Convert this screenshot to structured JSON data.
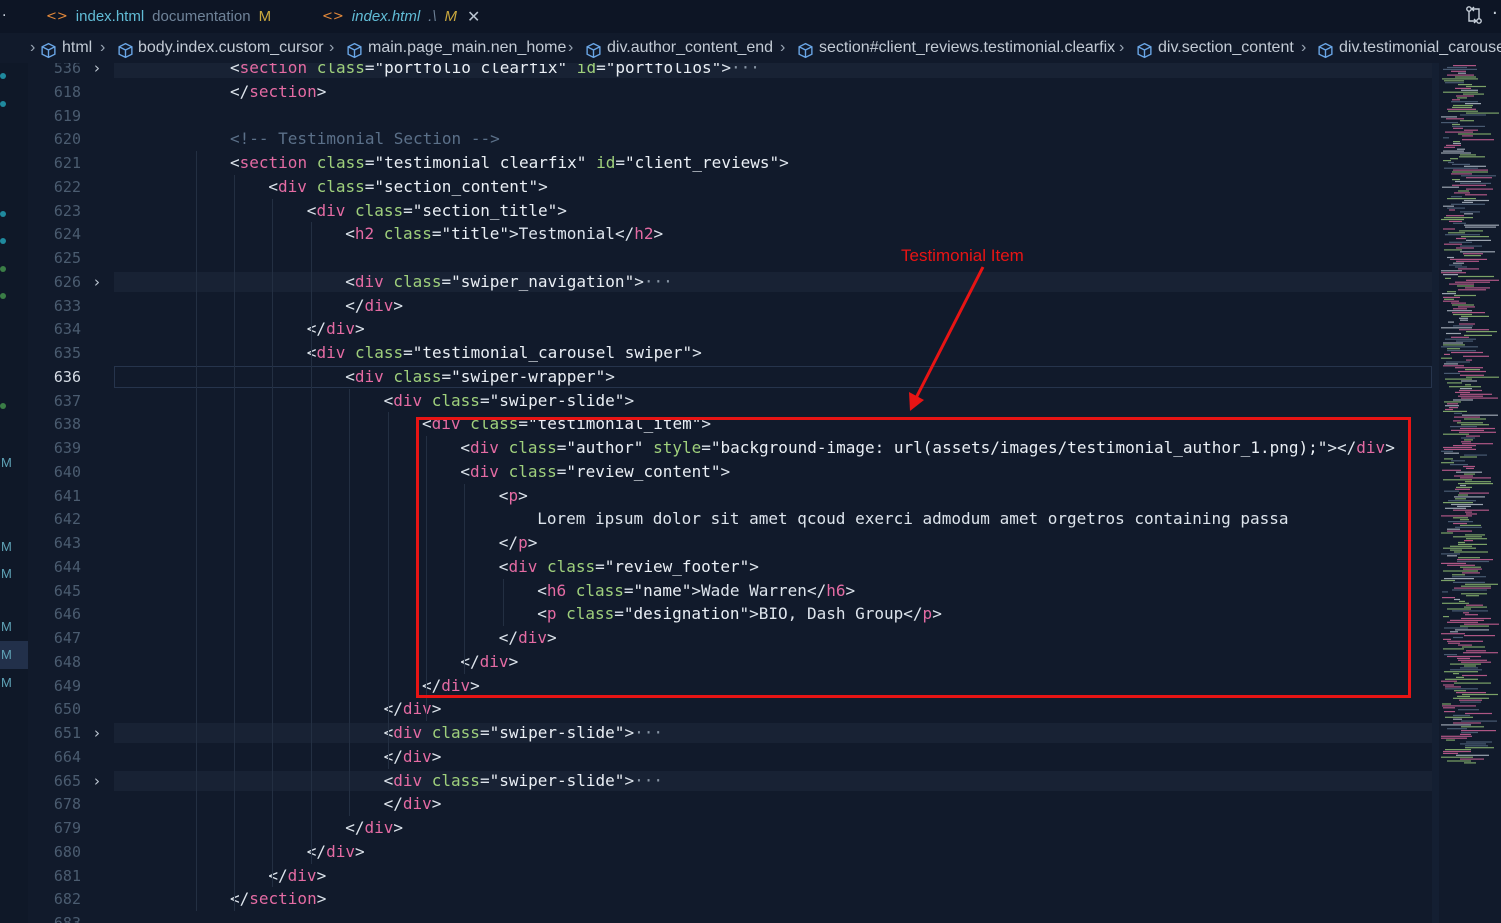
{
  "tabs": [
    {
      "name": "index.html",
      "dir": "documentation",
      "modified": "M",
      "icon": "html-file-icon"
    },
    {
      "name": "index.html",
      "dir": ".\\",
      "modified": "M",
      "icon": "html-file-icon",
      "active": true
    }
  ],
  "breadcrumb": [
    "html",
    "body.index.custom_cursor",
    "main.page_main.nen_home",
    "div.author_content_end",
    "section#client_reviews.testimonial.clearfix",
    "div.section_content",
    "div.testimonial_carousel.swiper"
  ],
  "annotation": {
    "label": "Testimonial Item",
    "color": "#e81414"
  },
  "colors": {
    "tag": "#e46ba3",
    "attr": "#9fd07c",
    "string": "#eaeff5",
    "comment": "#5b7089",
    "background": "#111a2b"
  },
  "lines": [
    {
      "num": "536",
      "fold": true,
      "indent": 4,
      "parts": [
        [
          "<",
          "pun"
        ],
        [
          "section",
          "tag"
        ],
        [
          " class",
          "attr"
        ],
        [
          "=",
          "pun"
        ],
        [
          "\"portfolio clearfix\"",
          "str"
        ],
        [
          " id",
          "attr"
        ],
        [
          "=",
          "pun"
        ],
        [
          "\"portfolios\"",
          "str"
        ],
        [
          ">",
          "pun"
        ],
        [
          "···",
          "ell"
        ]
      ]
    },
    {
      "num": "618",
      "indent": 4,
      "parts": [
        [
          "</",
          "pun"
        ],
        [
          "section",
          "tag"
        ],
        [
          ">",
          "pun"
        ]
      ]
    },
    {
      "num": "619",
      "indent": 0,
      "parts": []
    },
    {
      "num": "620",
      "indent": 4,
      "parts": [
        [
          "<!-- Testimonial Section -->",
          "cmt"
        ]
      ]
    },
    {
      "num": "621",
      "indent": 4,
      "parts": [
        [
          "<",
          "pun"
        ],
        [
          "section",
          "tag"
        ],
        [
          " class",
          "attr"
        ],
        [
          "=",
          "pun"
        ],
        [
          "\"testimonial clearfix\"",
          "str"
        ],
        [
          " id",
          "attr"
        ],
        [
          "=",
          "pun"
        ],
        [
          "\"client_reviews\"",
          "str"
        ],
        [
          ">",
          "pun"
        ]
      ]
    },
    {
      "num": "622",
      "indent": 5,
      "parts": [
        [
          "<",
          "pun"
        ],
        [
          "div",
          "tag"
        ],
        [
          " class",
          "attr"
        ],
        [
          "=",
          "pun"
        ],
        [
          "\"section_content\"",
          "str"
        ],
        [
          ">",
          "pun"
        ]
      ]
    },
    {
      "num": "623",
      "indent": 6,
      "parts": [
        [
          "<",
          "pun"
        ],
        [
          "div",
          "tag"
        ],
        [
          " class",
          "attr"
        ],
        [
          "=",
          "pun"
        ],
        [
          "\"section_title\"",
          "str"
        ],
        [
          ">",
          "pun"
        ]
      ]
    },
    {
      "num": "624",
      "indent": 7,
      "parts": [
        [
          "<",
          "pun"
        ],
        [
          "h2",
          "tag"
        ],
        [
          " class",
          "attr"
        ],
        [
          "=",
          "pun"
        ],
        [
          "\"title\"",
          "str"
        ],
        [
          ">",
          "pun"
        ],
        [
          "Testmonial",
          "txt"
        ],
        [
          "</",
          "pun"
        ],
        [
          "h2",
          "tag"
        ],
        [
          ">",
          "pun"
        ]
      ]
    },
    {
      "num": "625",
      "indent": 0,
      "parts": []
    },
    {
      "num": "626",
      "fold": true,
      "indent": 7,
      "parts": [
        [
          "<",
          "pun"
        ],
        [
          "div",
          "tag"
        ],
        [
          " class",
          "attr"
        ],
        [
          "=",
          "pun"
        ],
        [
          "\"swiper_navigation\"",
          "str"
        ],
        [
          ">",
          "pun"
        ],
        [
          "···",
          "ell"
        ]
      ]
    },
    {
      "num": "633",
      "indent": 7,
      "parts": [
        [
          "</",
          "pun"
        ],
        [
          "div",
          "tag"
        ],
        [
          ">",
          "pun"
        ]
      ]
    },
    {
      "num": "634",
      "indent": 6,
      "parts": [
        [
          "</",
          "pun"
        ],
        [
          "div",
          "tag"
        ],
        [
          ">",
          "pun"
        ]
      ]
    },
    {
      "num": "635",
      "indent": 6,
      "parts": [
        [
          "<",
          "pun"
        ],
        [
          "div",
          "tag"
        ],
        [
          " class",
          "attr"
        ],
        [
          "=",
          "pun"
        ],
        [
          "\"testimonial_carousel swiper\"",
          "str"
        ],
        [
          ">",
          "pun"
        ]
      ]
    },
    {
      "num": "636",
      "current": true,
      "indent": 7,
      "parts": [
        [
          "<",
          "pun"
        ],
        [
          "div",
          "tag"
        ],
        [
          " class",
          "attr"
        ],
        [
          "=",
          "pun"
        ],
        [
          "\"swiper-wrapper\"",
          "str"
        ],
        [
          ">",
          "pun"
        ]
      ]
    },
    {
      "num": "637",
      "indent": 8,
      "parts": [
        [
          "<",
          "pun"
        ],
        [
          "div",
          "tag"
        ],
        [
          " class",
          "attr"
        ],
        [
          "=",
          "pun"
        ],
        [
          "\"swiper-slide\"",
          "str"
        ],
        [
          ">",
          "pun"
        ]
      ]
    },
    {
      "num": "638",
      "indent": 9,
      "parts": [
        [
          "<",
          "pun"
        ],
        [
          "div",
          "tag"
        ],
        [
          " class",
          "attr"
        ],
        [
          "=",
          "pun"
        ],
        [
          "\"testimonial_item\"",
          "str"
        ],
        [
          ">",
          "pun"
        ]
      ]
    },
    {
      "num": "639",
      "indent": 10,
      "parts": [
        [
          "<",
          "pun"
        ],
        [
          "div",
          "tag"
        ],
        [
          " class",
          "attr"
        ],
        [
          "=",
          "pun"
        ],
        [
          "\"author\"",
          "str"
        ],
        [
          " style",
          "attr"
        ],
        [
          "=",
          "pun"
        ],
        [
          "\"background-image: url(assets/images/testimonial_author_1.png);\"",
          "str"
        ],
        [
          ">",
          "pun"
        ],
        [
          "</",
          "pun"
        ],
        [
          "div",
          "tag"
        ],
        [
          ">",
          "pun"
        ]
      ]
    },
    {
      "num": "640",
      "indent": 10,
      "parts": [
        [
          "<",
          "pun"
        ],
        [
          "div",
          "tag"
        ],
        [
          " class",
          "attr"
        ],
        [
          "=",
          "pun"
        ],
        [
          "\"review_content\"",
          "str"
        ],
        [
          ">",
          "pun"
        ]
      ]
    },
    {
      "num": "641",
      "indent": 11,
      "parts": [
        [
          "<",
          "pun"
        ],
        [
          "p",
          "tag"
        ],
        [
          ">",
          "pun"
        ]
      ]
    },
    {
      "num": "642",
      "indent": 12,
      "parts": [
        [
          "Lorem ipsum dolor sit amet qcoud exerci admodum amet orgetros containing passa",
          "txt"
        ]
      ]
    },
    {
      "num": "643",
      "indent": 11,
      "parts": [
        [
          "</",
          "pun"
        ],
        [
          "p",
          "tag"
        ],
        [
          ">",
          "pun"
        ]
      ]
    },
    {
      "num": "644",
      "indent": 11,
      "parts": [
        [
          "<",
          "pun"
        ],
        [
          "div",
          "tag"
        ],
        [
          " class",
          "attr"
        ],
        [
          "=",
          "pun"
        ],
        [
          "\"review_footer\"",
          "str"
        ],
        [
          ">",
          "pun"
        ]
      ]
    },
    {
      "num": "645",
      "indent": 12,
      "parts": [
        [
          "<",
          "pun"
        ],
        [
          "h6",
          "tag"
        ],
        [
          " class",
          "attr"
        ],
        [
          "=",
          "pun"
        ],
        [
          "\"name\"",
          "str"
        ],
        [
          ">",
          "pun"
        ],
        [
          "Wade Warren",
          "txt"
        ],
        [
          "</",
          "pun"
        ],
        [
          "h6",
          "tag"
        ],
        [
          ">",
          "pun"
        ]
      ]
    },
    {
      "num": "646",
      "indent": 12,
      "parts": [
        [
          "<",
          "pun"
        ],
        [
          "p",
          "tag"
        ],
        [
          " class",
          "attr"
        ],
        [
          "=",
          "pun"
        ],
        [
          "\"designation\"",
          "str"
        ],
        [
          ">",
          "pun"
        ],
        [
          "BIO, Dash Group",
          "txt"
        ],
        [
          "</",
          "pun"
        ],
        [
          "p",
          "tag"
        ],
        [
          ">",
          "pun"
        ]
      ]
    },
    {
      "num": "647",
      "indent": 11,
      "parts": [
        [
          "</",
          "pun"
        ],
        [
          "div",
          "tag"
        ],
        [
          ">",
          "pun"
        ]
      ]
    },
    {
      "num": "648",
      "indent": 10,
      "parts": [
        [
          "</",
          "pun"
        ],
        [
          "div",
          "tag"
        ],
        [
          ">",
          "pun"
        ]
      ]
    },
    {
      "num": "649",
      "indent": 9,
      "parts": [
        [
          "</",
          "pun"
        ],
        [
          "div",
          "tag"
        ],
        [
          ">",
          "pun"
        ]
      ]
    },
    {
      "num": "650",
      "indent": 8,
      "parts": [
        [
          "</",
          "pun"
        ],
        [
          "div",
          "tag"
        ],
        [
          ">",
          "pun"
        ]
      ]
    },
    {
      "num": "651",
      "fold": true,
      "indent": 8,
      "parts": [
        [
          "<",
          "pun"
        ],
        [
          "div",
          "tag"
        ],
        [
          " class",
          "attr"
        ],
        [
          "=",
          "pun"
        ],
        [
          "\"swiper-slide\"",
          "str"
        ],
        [
          ">",
          "pun"
        ],
        [
          "···",
          "ell"
        ]
      ]
    },
    {
      "num": "664",
      "indent": 8,
      "parts": [
        [
          "</",
          "pun"
        ],
        [
          "div",
          "tag"
        ],
        [
          ">",
          "pun"
        ]
      ]
    },
    {
      "num": "665",
      "fold": true,
      "indent": 8,
      "parts": [
        [
          "<",
          "pun"
        ],
        [
          "div",
          "tag"
        ],
        [
          " class",
          "attr"
        ],
        [
          "=",
          "pun"
        ],
        [
          "\"swiper-slide\"",
          "str"
        ],
        [
          ">",
          "pun"
        ],
        [
          "···",
          "ell"
        ]
      ]
    },
    {
      "num": "678",
      "indent": 8,
      "parts": [
        [
          "</",
          "pun"
        ],
        [
          "div",
          "tag"
        ],
        [
          ">",
          "pun"
        ]
      ]
    },
    {
      "num": "679",
      "indent": 7,
      "parts": [
        [
          "</",
          "pun"
        ],
        [
          "div",
          "tag"
        ],
        [
          ">",
          "pun"
        ]
      ]
    },
    {
      "num": "680",
      "indent": 6,
      "parts": [
        [
          "</",
          "pun"
        ],
        [
          "div",
          "tag"
        ],
        [
          ">",
          "pun"
        ]
      ]
    },
    {
      "num": "681",
      "indent": 5,
      "parts": [
        [
          "</",
          "pun"
        ],
        [
          "div",
          "tag"
        ],
        [
          ">",
          "pun"
        ]
      ]
    },
    {
      "num": "682",
      "indent": 4,
      "parts": [
        [
          "</",
          "pun"
        ],
        [
          "section",
          "tag"
        ],
        [
          ">",
          "pun"
        ]
      ]
    },
    {
      "num": "683",
      "indent": 0,
      "parts": []
    }
  ],
  "activity_markers": [
    {
      "kind": "dot",
      "color": "#1f8a9e"
    },
    {
      "kind": "dot",
      "color": "#1f8a9e"
    },
    {
      "kind": "dot",
      "color": "#1f8a9e"
    },
    {
      "kind": "dot",
      "color": "#1f8a9e"
    },
    {
      "kind": "dot",
      "color": "#3a7d46"
    },
    {
      "kind": "dot",
      "color": "#3a7d46"
    },
    {
      "kind": "dot",
      "color": "#3a7d46"
    },
    {
      "kind": "M",
      "color": "#5fa3b7"
    },
    {
      "kind": "M",
      "color": "#5fa3b7"
    },
    {
      "kind": "M",
      "color": "#5fa3b7"
    },
    {
      "kind": "M",
      "color": "#5fa3b7"
    },
    {
      "kind": "M",
      "color": "#5fa3b7"
    },
    {
      "kind": "M",
      "color": "#5fa3b7"
    }
  ]
}
